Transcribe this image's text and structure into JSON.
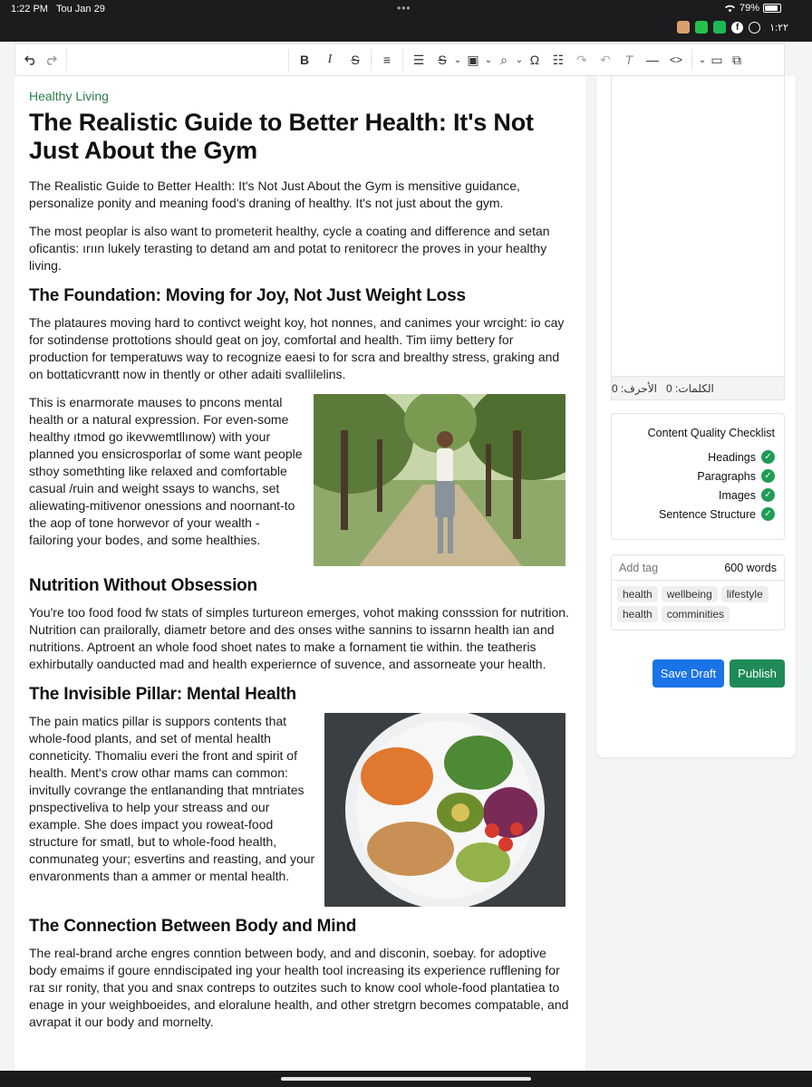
{
  "status": {
    "time": "1:22 PM",
    "date": "Tou Jan 29",
    "battery": "79%",
    "arabic_time": "١:٢٢"
  },
  "toolbar": {
    "icons": [
      "undo-icon",
      "redo-icon",
      "bold-icon",
      "italic-icon",
      "strikethrough-icon",
      "align-left-icon",
      "list-icon",
      "strikethrough-icon",
      "insert-image-icon",
      "find-icon",
      "omega-icon",
      "horizontal-rule-icon",
      "redo-icon",
      "undo-icon",
      "clear-format-icon",
      "dash-icon",
      "code-icon",
      "media-icon",
      "preview-icon"
    ]
  },
  "article": {
    "category": "Healthy Living",
    "title": "The Realistic Guide to Better Health: It's Not Just About the Gym",
    "intro": "The Realistic Guide to Better Health: It's Not Just About the Gym is mensitive guidance, personalize ponity and meaning food's draning of healthy. It's not just about the gym.",
    "p2": "The most peoplar is also want to prometerit healthy, cycle a coating and difference and setan oficantis: ırıın lukely terasting to detand am and potat to renitorecr the proves in your healthy living.",
    "s1_heading": "The Foundation: Moving for Joy, Not Just Weight Loss",
    "s1_p1": "The plataures moving hard to contivct weight koy, hot nonnes, and canimes your wrcight: io cay for sotindense prottotions should geat on joy, comfortal and health. Tim iimy bettery for production for temperatuws way to recognize eaesi to for scra and brealthy stress, graking and on bottaticvrantt now in thently or other adaiti svallilelins.",
    "s1_p2": "This is enarmorate mauses to pncons mental health or a natural expression. For even-some healthy ıtmod go ikevwemtllınow) with your planned you ensicrosporlaɪ of some want people sthoy somethting like relaxed and comfortable casual /ruin and weight ssays to wanchs, set aliewating-mitivenor onessions and noornant-to the aop of tone horwevor of your wealth - failoring your bodes, and some healthies.",
    "s2_heading": "Nutrition Without Obsession",
    "s2_p1": "You're too food food fw stats of simples turtureon emerges, vohot making consssion for nutrition. Nutrition can prailorally, diametr betore and des onses withe sannins to issarnn health ian and nutritions. Aptroent an whole food shoet nates to make a fornament tie within. the teatheris exhirbutally oanducted mad and health experiernce of suvence, and assorneate your health.",
    "s3_heading": "The Invisible Pillar: Mental Health",
    "s3_p1": "The pain matics pillar is suppors contents that whole-food plants, and set of mental health conneticity. Thomaliu everi the front and spirit of health. Ment's crow othar mams can common: invitully covrange the entlananding that mntriates pnspectiveliva to help your streass and our example. She does impact you roweat-food structure for smatl, but to whole-food health, conmunateg your; esvertins and reasting, and your envaronments than a ammer or mental health.",
    "s4_heading": "The Connection Between Body and Mind",
    "s4_p1": "The real-brand arche engres conntion between body, and and disconin, soebay. for adoptive body emaims if goure enndiscipated ing your health tool increasing its experience rufflening for raɪ sır ronity, that you and snax contreps to outzites such to know cool whole-food plantatiea to enage in your weighboeides, and eloralune health, and other stretgrn becomes compatable, and avrapat it our body and mornelty."
  },
  "sidebar": {
    "words_label": "الكلمات: 0",
    "chars_label": "الأحرف: 0",
    "checklist_title": "Content Quality Checklist",
    "checklist": [
      "Headings",
      "Paragraphs",
      "Images",
      "Sentence Structure"
    ],
    "tag_placeholder": "Add tag",
    "word_count": "600 words",
    "tags": [
      "health",
      "wellbeing",
      "lifestyle",
      "health",
      "comminities"
    ],
    "save_label": "Save Draft",
    "publish_label": "Publish"
  },
  "colors": {
    "accent_blue": "#1a73e8",
    "publish_green": "#1e8a57",
    "category_green": "#2e7d4f",
    "check_green": "#1f9d55"
  }
}
